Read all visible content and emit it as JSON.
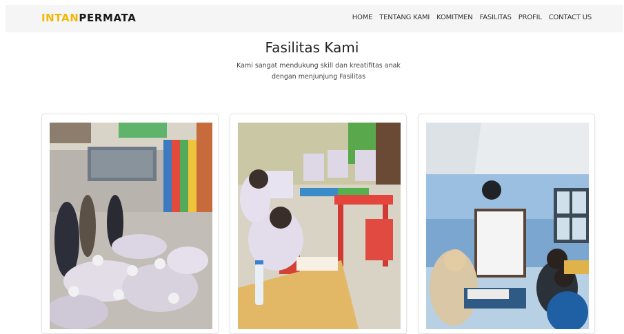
{
  "brand": {
    "part1": "INTAN",
    "part2": "PERMATA"
  },
  "nav": {
    "items": [
      {
        "label": "HOME"
      },
      {
        "label": "TENTANG KAMI"
      },
      {
        "label": "KOMITMEN"
      },
      {
        "label": "FASILITAS"
      },
      {
        "label": "PROFIL"
      },
      {
        "label": "CONTACT US"
      }
    ]
  },
  "section": {
    "title": "Fasilitas Kami",
    "subtitle_line1": "Kami sangat mendukung skill dan kreatifitas anak",
    "subtitle_line2": "dengan menjunjung Fasilitas"
  },
  "colors": {
    "brand_accent": "#f2b705",
    "brand_dark": "#1a1a1a"
  }
}
